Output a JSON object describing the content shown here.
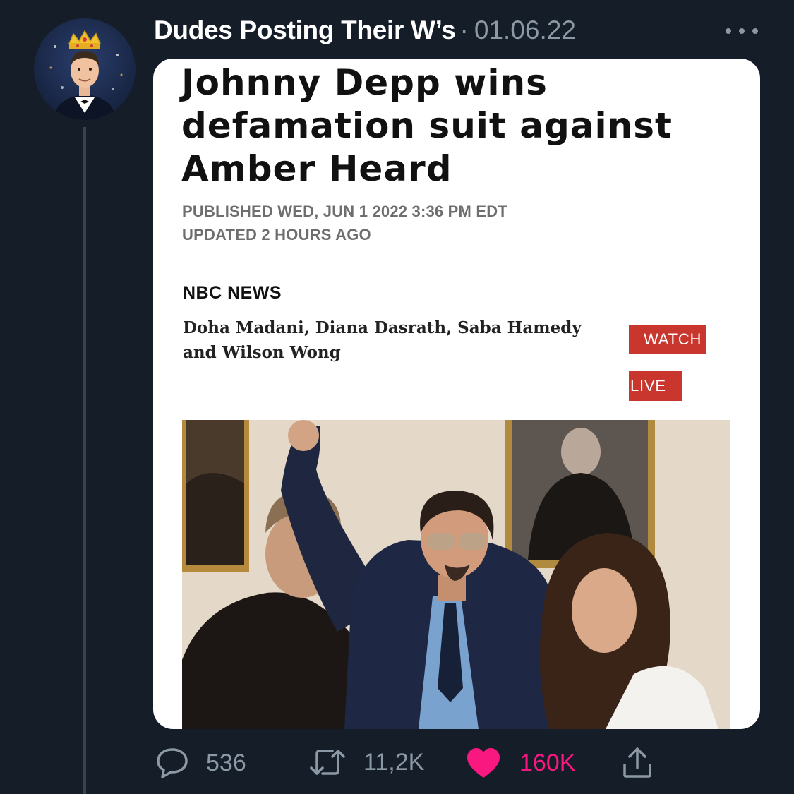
{
  "tweet": {
    "author_name": "Dudes Posting Their W’s",
    "separator": "·",
    "date": "01.06.22",
    "more_icon": "ellipsis-icon"
  },
  "article": {
    "headline": "Johnny Depp wins defamation suit against Amber Heard",
    "published": "PUBLISHED WED, JUN 1 2022 3:36 PM EDT",
    "updated": "UPDATED 2 HOURS AGO",
    "source": "NBC NEWS",
    "authors": "Doha Madani, Diana Dasrath, Saba Hamedy and Wilson Wong",
    "watch_label": "WATCH",
    "live_label": "LIVE",
    "badge_color": "#c8362d"
  },
  "actions": {
    "replies": "536",
    "retweets": "11,2K",
    "likes": "160K",
    "like_color": "#f91880"
  },
  "theme": {
    "background": "#151d29",
    "muted_text": "#8b98a5"
  }
}
